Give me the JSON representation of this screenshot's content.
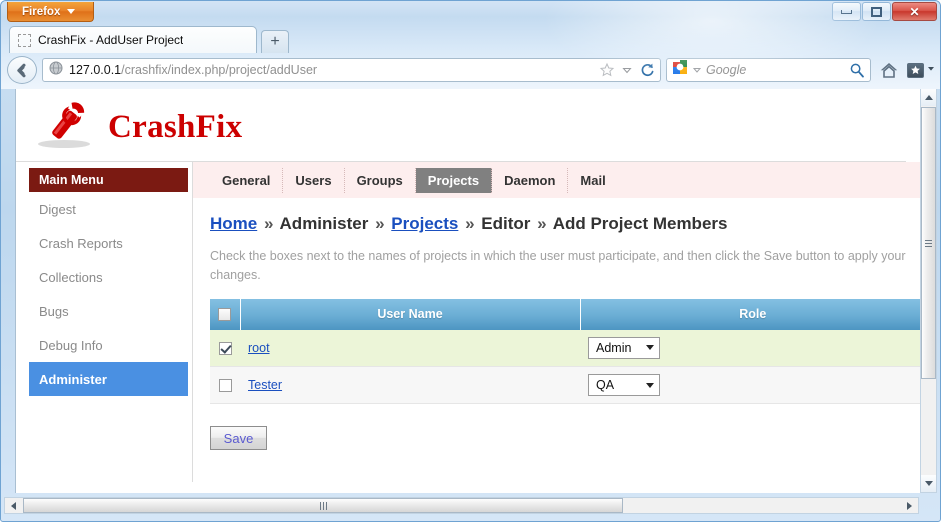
{
  "browser": {
    "app_button": "Firefox",
    "tab_title": "CrashFix - AddUser Project",
    "new_tab_label": "+",
    "url_host": "127.0.0.1",
    "url_path": "/crashfix/index.php/project/addUser",
    "search_placeholder": "Google",
    "window_controls": {
      "minimize": "minimize",
      "maximize": "maximize",
      "close": "✕"
    }
  },
  "site": {
    "logo_text": "CrashFix"
  },
  "sidebar": {
    "header": "Main Menu",
    "items": [
      {
        "label": "Digest",
        "active": false
      },
      {
        "label": "Crash Reports",
        "active": false
      },
      {
        "label": "Collections",
        "active": false
      },
      {
        "label": "Bugs",
        "active": false
      },
      {
        "label": "Debug Info",
        "active": false
      },
      {
        "label": "Administer",
        "active": true
      }
    ]
  },
  "nav_tabs": [
    {
      "label": "General",
      "active": false
    },
    {
      "label": "Users",
      "active": false
    },
    {
      "label": "Groups",
      "active": false
    },
    {
      "label": "Projects",
      "active": true
    },
    {
      "label": "Daemon",
      "active": false
    },
    {
      "label": "Mail",
      "active": false
    }
  ],
  "breadcrumb": [
    {
      "label": "Home",
      "link": true
    },
    {
      "label": "Administer",
      "link": false
    },
    {
      "label": "Projects",
      "link": true
    },
    {
      "label": "Editor",
      "link": false
    },
    {
      "label": "Add Project Members",
      "link": false
    }
  ],
  "breadcrumb_separator": "»",
  "main": {
    "description": "Check the boxes next to the names of projects in which the user must participate, and then click the Save button to apply your changes.",
    "table": {
      "columns": [
        "",
        "User Name",
        "Role"
      ],
      "select_all_checked": false,
      "rows": [
        {
          "checked": true,
          "user_name": "root",
          "role": "Admin"
        },
        {
          "checked": false,
          "user_name": "Tester",
          "role": "QA"
        }
      ]
    },
    "save_label": "Save"
  },
  "colors": {
    "brand_red": "#cc0000",
    "menu_header": "#7b1a12",
    "menu_active": "#4a90e2",
    "table_header_blue": "#6aadd4",
    "row_even": "#ecf5d8",
    "row_odd": "#f7f7f7",
    "link_blue": "#1a4fbf"
  }
}
